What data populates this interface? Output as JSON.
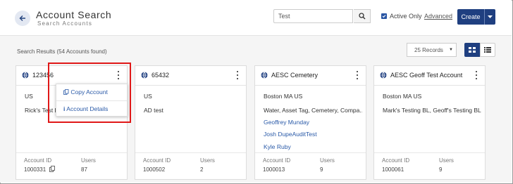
{
  "header": {
    "title": "Account Search",
    "subtitle": "Search Accounts",
    "search_value": "Test",
    "active_only_label": "Active Only",
    "advanced_label": "Advanced",
    "create_label": "Create"
  },
  "results": {
    "label": "Search Results (54 Accounts found)",
    "records_select": "25 Records"
  },
  "cards": [
    {
      "name": "123456",
      "lines": [
        "US",
        "Rick's Test BL"
      ],
      "account_id_label": "Account ID",
      "account_id": "1000331",
      "users_label": "Users",
      "users": "87"
    },
    {
      "name": "65432",
      "lines": [
        "US",
        "AD test"
      ],
      "account_id_label": "Account ID",
      "account_id": "1000502",
      "users_label": "Users",
      "users": "2"
    },
    {
      "name": "AESC Cemetery",
      "lines": [
        "Boston MA US",
        "Water, Asset Tag, Cemetery, Compa..."
      ],
      "links": [
        "Geoffrey Munday",
        "Josh DupeAuditTest",
        "Kyle Ruby"
      ],
      "account_id_label": "Account ID",
      "account_id": "1000013",
      "users_label": "Users",
      "users": "9"
    },
    {
      "name": "AESC Geoff Test Account",
      "lines": [
        "Boston MA US",
        "Mark's Testing BL, Geoff's Testing BL"
      ],
      "account_id_label": "Account ID",
      "account_id": "1000061",
      "users_label": "Users",
      "users": "9"
    }
  ],
  "menu": {
    "copy_account": "Copy Account",
    "account_details": "Account Details"
  },
  "colors": {
    "primary": "#1f3f80",
    "link": "#2a5aa8",
    "highlight": "#e01818"
  }
}
